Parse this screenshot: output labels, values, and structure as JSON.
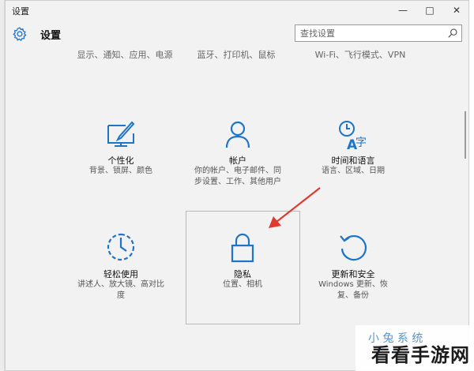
{
  "window": {
    "title": "设置",
    "minimize_glyph": "—",
    "maximize_glyph": "□",
    "close_glyph": "✕"
  },
  "header": {
    "icon": "gear-icon",
    "title": "设置",
    "search_placeholder": "查找设置",
    "search_icon": "search-icon"
  },
  "top_descriptions": [
    {
      "text": "显示、通知、应用、电源"
    },
    {
      "text": "蓝牙、打印机、鼠标"
    },
    {
      "text": "Wi-Fi、飞行模式、VPN"
    }
  ],
  "tiles": [
    {
      "name": "个性化",
      "desc": "背景、锁屏、颜色",
      "icon": "personalization-icon"
    },
    {
      "name": "帐户",
      "desc": "你的帐户、电子邮件、同步设置、工作、其他用户",
      "icon": "account-icon"
    },
    {
      "name": "时间和语言",
      "desc": "语言、区域、日期",
      "icon": "time-language-icon"
    },
    {
      "name": "轻松使用",
      "desc": "讲述人、放大镜、高对比度",
      "icon": "ease-of-access-icon"
    },
    {
      "name": "隐私",
      "desc": "位置、相机",
      "icon": "lock-icon"
    },
    {
      "name": "更新和安全",
      "desc": "Windows 更新、恢复、备份",
      "icon": "update-icon"
    }
  ],
  "colors": {
    "accent": "#1e74c8",
    "arrow": "#e03a30"
  },
  "watermark": {
    "small": "小 兔 系 统",
    "big": "看看手游网"
  }
}
